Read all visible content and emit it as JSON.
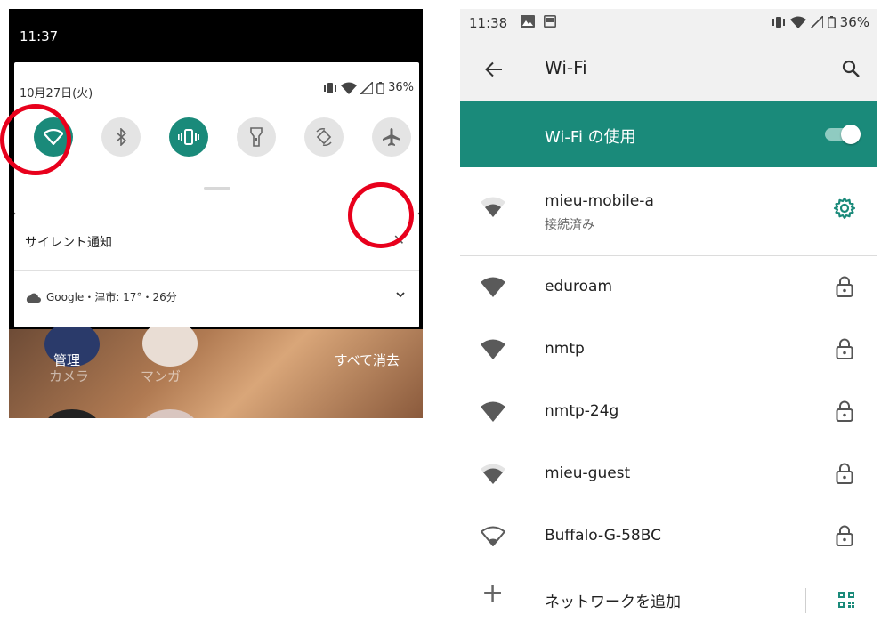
{
  "left": {
    "status_time": "11:37",
    "date": "10月27日(火)",
    "battery": "36%",
    "tiles": [
      {
        "name": "wifi",
        "on": true
      },
      {
        "name": "bluetooth",
        "on": false
      },
      {
        "name": "vibrate",
        "on": true
      },
      {
        "name": "flashlight",
        "on": false
      },
      {
        "name": "auto-rotate",
        "on": false
      },
      {
        "name": "airplane",
        "on": false
      }
    ],
    "notification": {
      "title": "サイレント通知",
      "close_symbol": "✕",
      "weather_text": "Google・津市: 17°・26分"
    },
    "manage_label": "管理",
    "clear_all_label": "すべて消去",
    "app_camera": "カメラ",
    "app_manga": "マンガ"
  },
  "right": {
    "status_time": "11:38",
    "battery": "36%",
    "title": "Wi-Fi",
    "wifi_toggle_label": "Wi-Fi の使用",
    "wifi_enabled": true,
    "networks": [
      {
        "ssid": "mieu-mobile-a",
        "status": "接続済み",
        "locked": false,
        "signal": 3
      },
      {
        "ssid": "eduroam",
        "status": "",
        "locked": true,
        "signal": 4
      },
      {
        "ssid": "nmtp",
        "status": "",
        "locked": true,
        "signal": 4
      },
      {
        "ssid": "nmtp-24g",
        "status": "",
        "locked": true,
        "signal": 4
      },
      {
        "ssid": "mieu-guest",
        "status": "",
        "locked": true,
        "signal": 3
      },
      {
        "ssid": "Buffalo-G-58BC",
        "status": "",
        "locked": true,
        "signal": 1
      }
    ],
    "add_network_label": "ネットワークを追加",
    "add_symbol": "+"
  },
  "colors": {
    "accent": "#1a8a7a",
    "highlight_ring": "#e8001c"
  }
}
